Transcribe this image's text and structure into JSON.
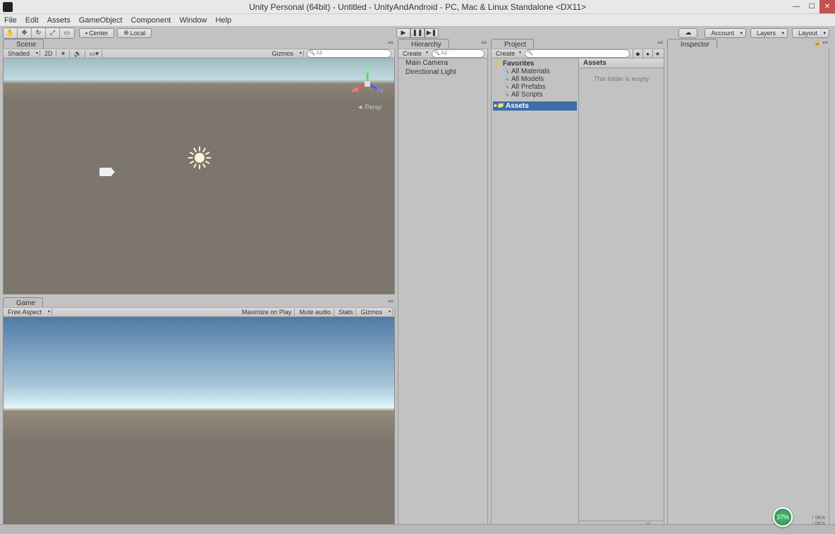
{
  "window": {
    "title": "Unity Personal (64bit) - Untitled - UnityAndAndroid - PC, Mac & Linux Standalone <DX11>"
  },
  "menu": [
    "File",
    "Edit",
    "Assets",
    "GameObject",
    "Component",
    "Window",
    "Help"
  ],
  "toolbar": {
    "pivot": "Center",
    "space": "Local",
    "account": "Account",
    "layers": "Layers",
    "layout": "Layout"
  },
  "scene": {
    "tab": "Scene",
    "shading": "Shaded",
    "mode2d": "2D",
    "gizmos": "Gizmos",
    "search_placeholder": "All",
    "persp": "Persp"
  },
  "game": {
    "tab": "Game",
    "aspect": "Free Aspect",
    "maximize": "Maximize on Play",
    "mute": "Mute audio",
    "stats": "Stats",
    "gizmos": "Gizmos"
  },
  "hierarchy": {
    "tab": "Hierarchy",
    "create": "Create",
    "search_placeholder": "All",
    "items": [
      "Main Camera",
      "Directional Light"
    ]
  },
  "project": {
    "tab": "Project",
    "create": "Create",
    "favorites": "Favorites",
    "fav_items": [
      "All Materials",
      "All Models",
      "All Prefabs",
      "All Scripts"
    ],
    "assets": "Assets",
    "header": "Assets",
    "empty": "This folder is empty"
  },
  "inspector": {
    "tab": "Inspector"
  },
  "system": {
    "badge": "37%",
    "net_up": "0K/s",
    "net_down": "0K/s"
  }
}
